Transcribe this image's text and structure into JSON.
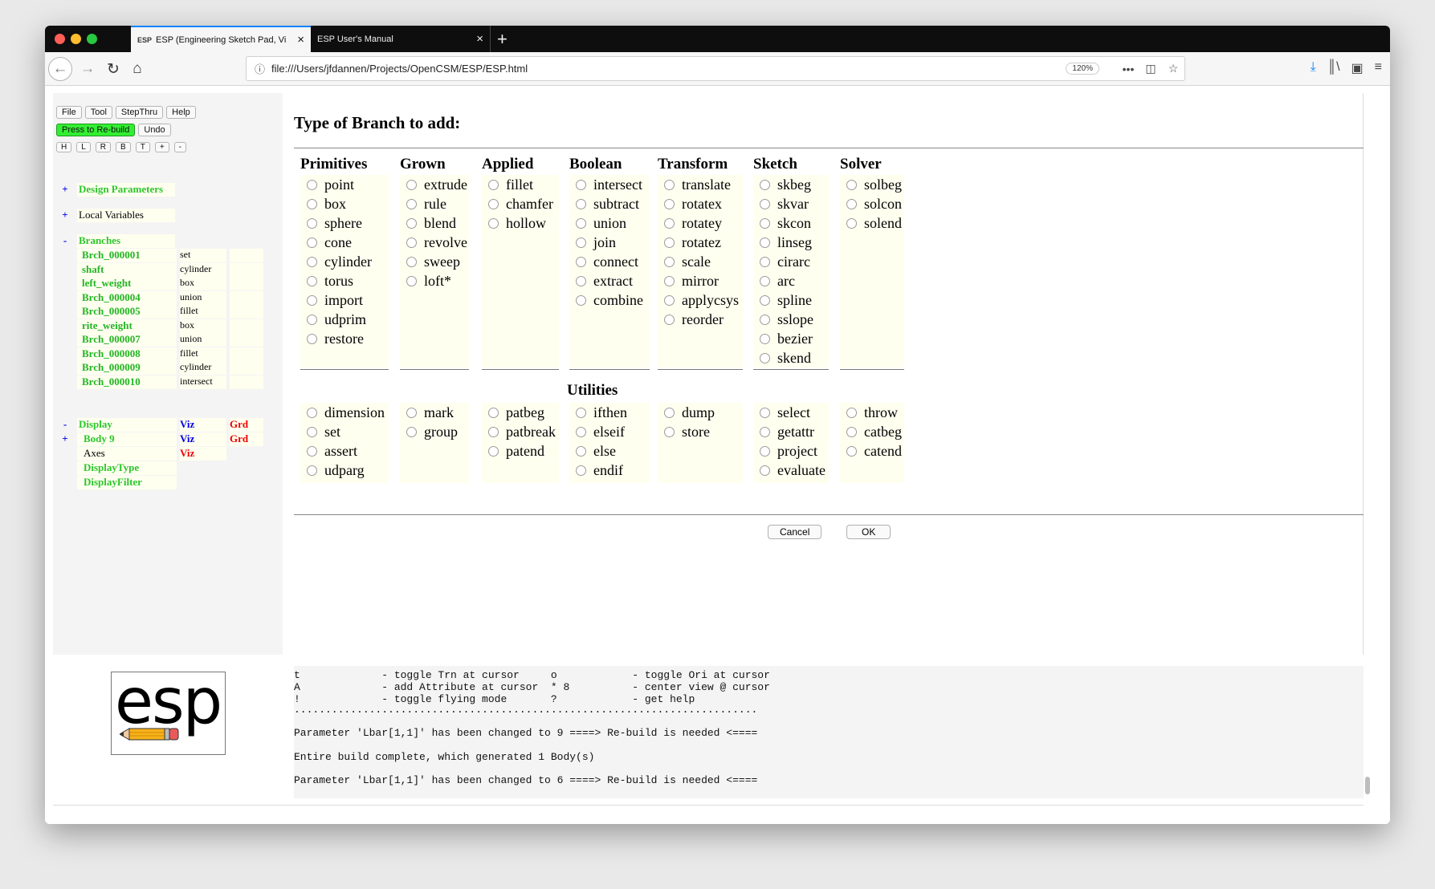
{
  "browser": {
    "tabs": [
      {
        "label": "ESP (Engineering Sketch Pad, Vi",
        "favicon": "ESP",
        "active": true
      },
      {
        "label": "ESP User's Manual",
        "active": false
      }
    ],
    "url": "file:///Users/jfdannen/Projects/OpenCSM/ESP/ESP.html",
    "zoom": "120%"
  },
  "menu": {
    "buttons": [
      "File",
      "Tool",
      "StepThru",
      "Help"
    ],
    "rebuild": "Press to Re-build",
    "undo": "Undo",
    "views": [
      "H",
      "L",
      "R",
      "B",
      "T",
      "+",
      "-"
    ]
  },
  "tree": {
    "design_parameters": {
      "sign": "+",
      "label": "Design Parameters"
    },
    "local_variables": {
      "sign": "+",
      "label": "Local Variables"
    },
    "branches": {
      "sign": "-",
      "label": "Branches",
      "items": [
        {
          "name": "Brch_000001",
          "type": "set"
        },
        {
          "name": "shaft",
          "type": "cylinder"
        },
        {
          "name": "left_weight",
          "type": "box"
        },
        {
          "name": "Brch_000004",
          "type": "union"
        },
        {
          "name": "Brch_000005",
          "type": "fillet"
        },
        {
          "name": "rite_weight",
          "type": "box"
        },
        {
          "name": "Brch_000007",
          "type": "union"
        },
        {
          "name": "Brch_000008",
          "type": "fillet"
        },
        {
          "name": "Brch_000009",
          "type": "cylinder"
        },
        {
          "name": "Brch_000010",
          "type": "intersect"
        }
      ]
    },
    "display": {
      "sign": "-",
      "label": "Display",
      "viz": "Viz",
      "grd": "Grd"
    },
    "body": {
      "sign": "+",
      "label": "Body 9",
      "viz": "Viz",
      "grd": "Grd"
    },
    "axes": {
      "label": "Axes",
      "viz": "Viz"
    },
    "display_type": "DisplayType",
    "display_filter": "DisplayFilter"
  },
  "dialog": {
    "title": "Type of Branch to add:",
    "columns": [
      {
        "head": "Primitives",
        "items": [
          "point",
          "box",
          "sphere",
          "cone",
          "cylinder",
          "torus",
          "import",
          "udprim",
          "restore"
        ],
        "utilities": [
          "dimension",
          "set",
          "assert",
          "udparg"
        ]
      },
      {
        "head": "Grown",
        "items": [
          "extrude",
          "rule",
          "blend",
          "revolve",
          "sweep",
          "loft*"
        ],
        "utilities": [
          "mark",
          "group"
        ]
      },
      {
        "head": "Applied",
        "items": [
          "fillet",
          "chamfer",
          "hollow"
        ],
        "utilities": [
          "patbeg",
          "patbreak",
          "patend"
        ]
      },
      {
        "head": "Boolean",
        "items": [
          "intersect",
          "subtract",
          "union",
          "join",
          "connect",
          "extract",
          "combine"
        ],
        "utilities": [
          "ifthen",
          "elseif",
          "else",
          "endif"
        ]
      },
      {
        "head": "Transform",
        "items": [
          "translate",
          "rotatex",
          "rotatey",
          "rotatez",
          "scale",
          "mirror",
          "applycsys",
          "reorder"
        ],
        "utilities": [
          "dump",
          "store"
        ]
      },
      {
        "head": "Sketch",
        "items": [
          "skbeg",
          "skvar",
          "skcon",
          "linseg",
          "cirarc",
          "arc",
          "spline",
          "sslope",
          "bezier",
          "skend"
        ],
        "utilities": [
          "select",
          "getattr",
          "project",
          "evaluate"
        ]
      },
      {
        "head": "Solver",
        "items": [
          "solbeg",
          "solcon",
          "solend"
        ],
        "utilities": [
          "throw",
          "catbeg",
          "catend"
        ]
      }
    ],
    "utilities_label": "Utilities",
    "cancel": "Cancel",
    "ok": "OK"
  },
  "console": {
    "lines": [
      "t             - toggle Trn at cursor     o            - toggle Ori at cursor",
      "A             - add Attribute at cursor  * 8          - center view @ cursor",
      "!             - toggle flying mode       ?            - get help",
      "..........................................................................",
      "Parameter 'Lbar[1,1]' has been changed to 9 ====> Re-build is needed <====",
      "Entire build complete, which generated 1 Body(s)",
      "Parameter 'Lbar[1,1]' has been changed to 6 ====> Re-build is needed <===="
    ]
  },
  "logo_text": "esp"
}
